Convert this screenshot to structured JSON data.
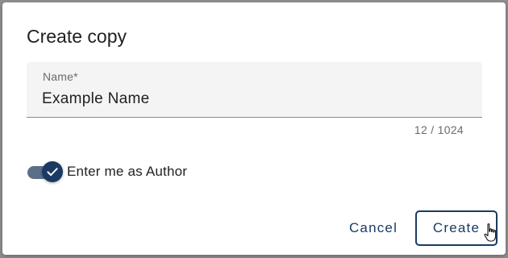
{
  "dialog": {
    "title": "Create copy",
    "name_field": {
      "label": "Name*",
      "value": "Example Name",
      "counter": "12 / 1024"
    },
    "author_toggle": {
      "label": "Enter me as Author",
      "checked": true
    },
    "actions": {
      "cancel_label": "Cancel",
      "create_label": "Create"
    }
  },
  "colors": {
    "accent": "#1b3a63",
    "toggle_track": "#5c6f89",
    "field_bg": "#f4f4f4",
    "backdrop": "#8e8e8e"
  },
  "icons": {
    "toggle_check": "check-icon",
    "cursor": "hand-pointer-cursor-icon"
  }
}
